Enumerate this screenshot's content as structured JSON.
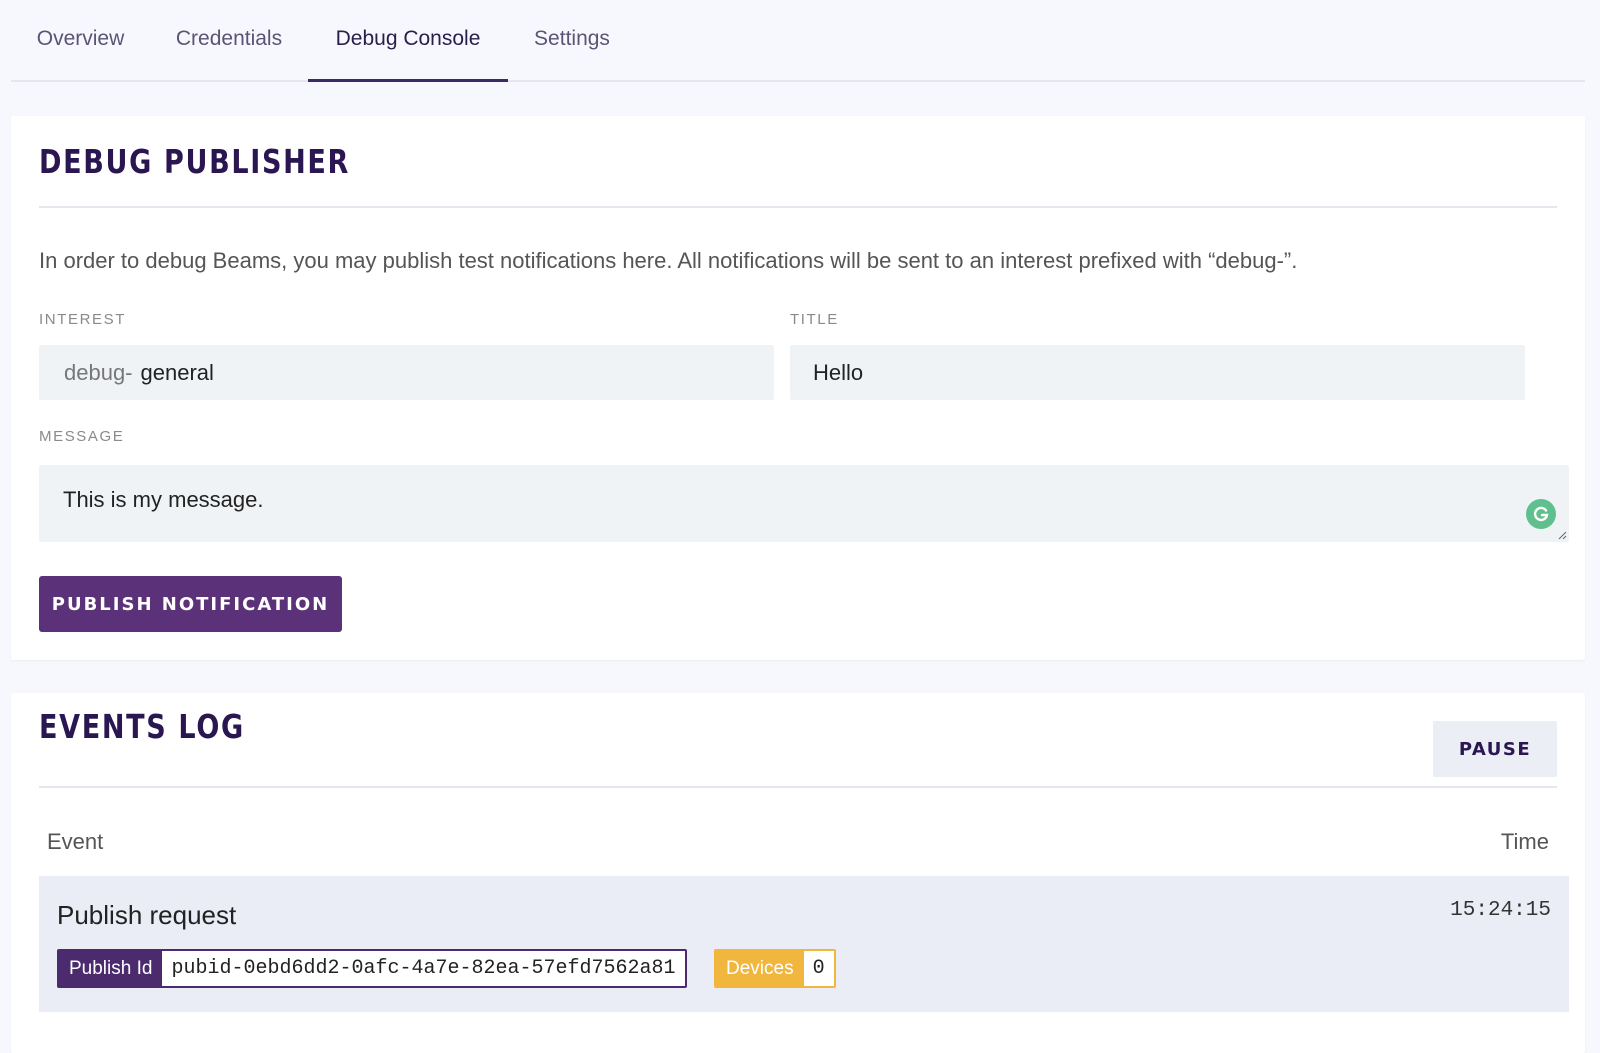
{
  "tabs": [
    {
      "label": "Overview"
    },
    {
      "label": "Credentials"
    },
    {
      "label": "Debug Console"
    },
    {
      "label": "Settings"
    }
  ],
  "active_tab": "Debug Console",
  "publisher": {
    "title": "DEBUG PUBLISHER",
    "description": "In order to debug Beams, you may publish test notifications here. All notifications will be sent to an interest prefixed with “debug-”.",
    "interest_label": "INTEREST",
    "interest_prefix": "debug-",
    "interest_value": "general",
    "title_label": "TITLE",
    "title_value": "Hello",
    "message_label": "MESSAGE",
    "message_value": "This is my message.",
    "publish_button": "PUBLISH NOTIFICATION"
  },
  "events_log": {
    "title": "EVENTS LOG",
    "pause_button": "PAUSE",
    "col_event": "Event",
    "col_time": "Time",
    "events": [
      {
        "name": "Publish request",
        "time": "15:24:15",
        "publish_id_label": "Publish Id",
        "publish_id": "pubid-0ebd6dd2-0afc-4a7e-82ea-57efd7562a81",
        "devices_label": "Devices",
        "devices": "0"
      }
    ]
  },
  "colors": {
    "accent": "#5b3279",
    "title_text": "#2a1650",
    "devices_badge": "#f0b63d",
    "grammarly": "#5fc08d"
  },
  "icons": {
    "grammarly": "grammarly-icon",
    "resize": "resize-handle-icon"
  }
}
